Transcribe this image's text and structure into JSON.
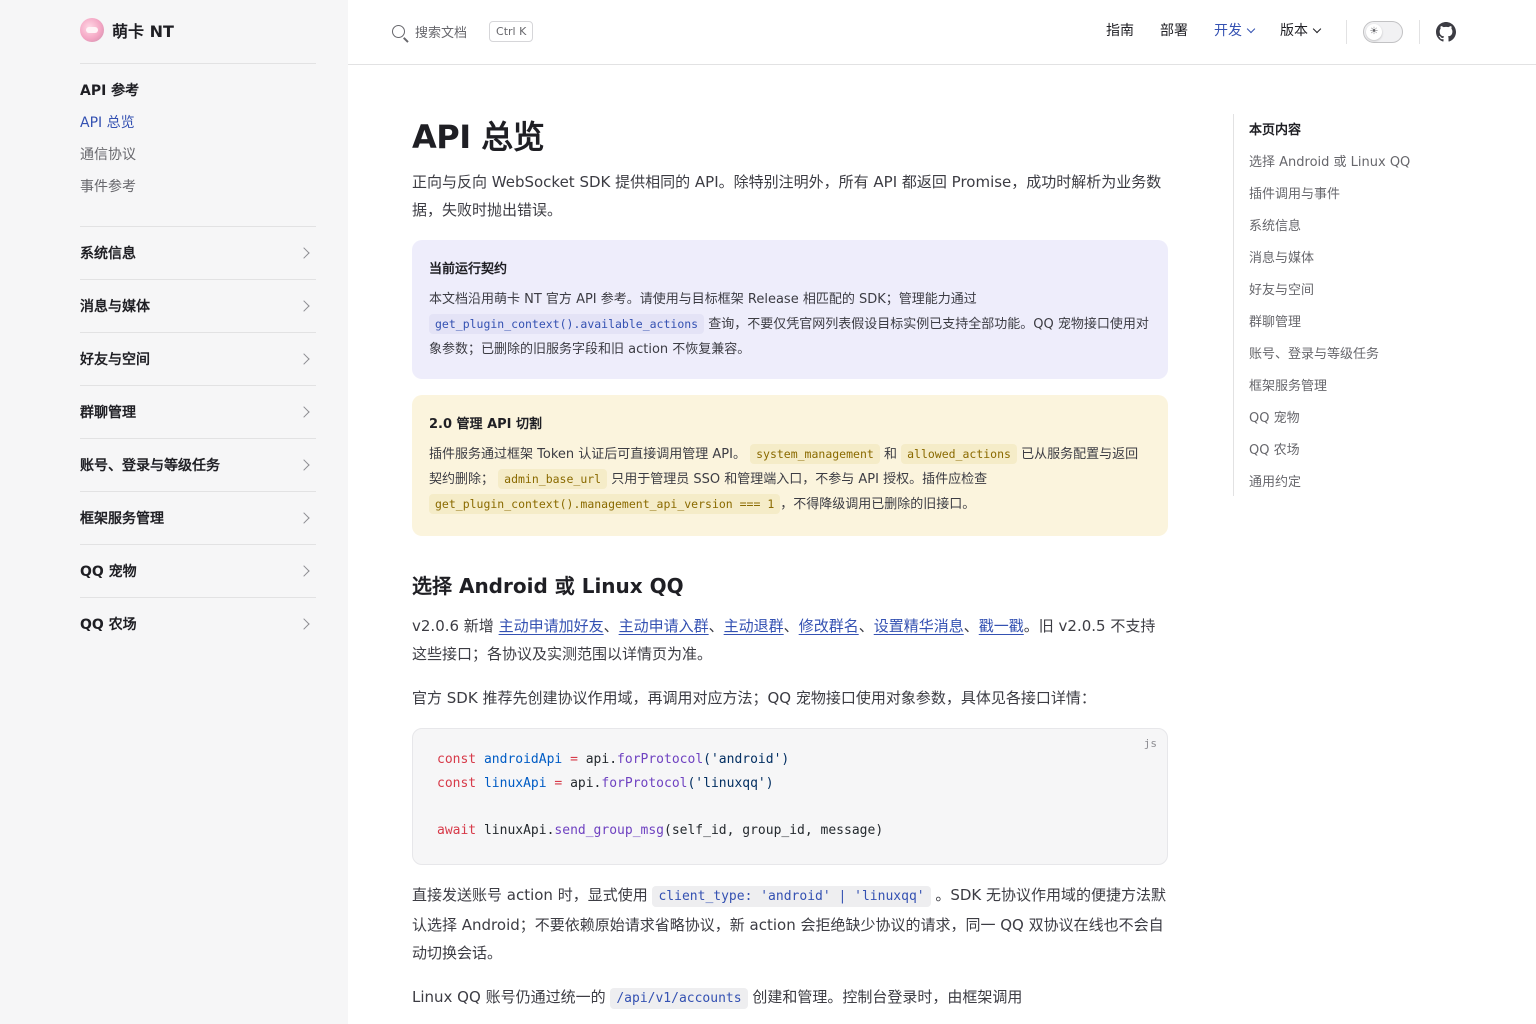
{
  "brand": {
    "title": "萌卡 NT"
  },
  "sidebar": {
    "group_title": "API 参考",
    "links": [
      {
        "label": "API 总览",
        "active": true
      },
      {
        "label": "通信协议",
        "active": false
      },
      {
        "label": "事件参考",
        "active": false
      }
    ],
    "sections": [
      {
        "label": "系统信息"
      },
      {
        "label": "消息与媒体"
      },
      {
        "label": "好友与空间"
      },
      {
        "label": "群聊管理"
      },
      {
        "label": "账号、登录与等级任务"
      },
      {
        "label": "框架服务管理"
      },
      {
        "label": "QQ 宠物"
      },
      {
        "label": "QQ 农场"
      }
    ]
  },
  "topnav": {
    "search_placeholder": "搜索文档",
    "search_shortcut": "Ctrl K",
    "items": [
      {
        "label": "指南",
        "active": false,
        "dropdown": false
      },
      {
        "label": "部署",
        "active": false,
        "dropdown": false
      },
      {
        "label": "开发",
        "active": true,
        "dropdown": true
      },
      {
        "label": "版本",
        "active": false,
        "dropdown": true
      }
    ],
    "theme_icon": "sun-icon",
    "github_icon": "github-icon"
  },
  "main": {
    "title": "API 总览",
    "intro": "正向与反向 WebSocket SDK 提供相同的 API。除特别注明外，所有 API 都返回 Promise，成功时解析为业务数据，失败时抛出错误。",
    "callout_info": {
      "title": "当前运行契约",
      "text1": "本文档沿用萌卡 NT 官方 API 参考。请使用与目标框架 Release 相匹配的 SDK；管理能力通过",
      "code1": "get_plugin_context().available_actions",
      "text2": "查询，不要仅凭官网列表假设目标实例已支持全部功能。QQ 宠物接口使用对象参数；已删除的旧服务字段和旧 action 不恢复兼容。"
    },
    "callout_warn": {
      "title": "2.0 管理 API 切割",
      "text1": "插件服务通过框架 Token 认证后可直接调用管理 API。",
      "code1": "system_management",
      "text2": "和",
      "code2": "allowed_actions",
      "text3": "已从服务配置与返回契约删除；",
      "code3": "admin_base_url",
      "text4": "只用于管理员 SSO 和管理端入口，不参与 API 授权。插件应检查",
      "code4": "get_plugin_context().management_api_version === 1",
      "text5": "，不得降级调用已删除的旧接口。"
    },
    "section_title": "选择 Android 或 Linux QQ",
    "p1": {
      "prefix": "v2.0.6 新增 ",
      "links": [
        "主动申请加好友",
        "主动申请入群",
        "主动退群",
        "修改群名",
        "设置精华消息",
        "戳一戳"
      ],
      "sep": "、",
      "suffix": "。旧 v2.0.5 不支持这些接口；各协议及实测范围以详情页为准。"
    },
    "p2": "官方 SDK 推荐先创建协议作用域，再调用对应方法；QQ 宠物接口使用对象参数，具体见各接口详情：",
    "code_block": {
      "lang": "js",
      "line1": {
        "kw": "const",
        "var": "androidApi",
        "eq": " = ",
        "obj": "api.",
        "fn": "forProtocol",
        "args": "('android')"
      },
      "line2": {
        "kw": "const",
        "var": "linuxApi",
        "eq": " = ",
        "obj": "api.",
        "fn": "forProtocol",
        "args": "('linuxqq')"
      },
      "line3": {
        "kw": "await",
        "obj": " linuxApi.",
        "fn": "send_group_msg",
        "args": "(self_id, group_id, message)"
      }
    },
    "p3": {
      "text1": "直接发送账号 action 时，显式使用 ",
      "code": "client_type: 'android' | 'linuxqq'",
      "text2": " 。SDK 无协议作用域的便捷方法默认选择 Android；不要依赖原始请求省略协议，新 action 会拒绝缺少协议的请求，同一 QQ 双协议在线也不会自动切换会话。"
    },
    "p4": {
      "text1": "Linux QQ 账号仍通过统一的 ",
      "code": "/api/v1/accounts",
      "text2": " 创建和管理。控制台登录时，由框架调用"
    }
  },
  "toc": {
    "title": "本页内容",
    "items": [
      "选择 Android 或 Linux QQ",
      "插件调用与事件",
      "系统信息",
      "消息与媒体",
      "好友与空间",
      "群聊管理",
      "账号、登录与等级任务",
      "框架服务管理",
      "QQ 宠物",
      "QQ 农场",
      "通用约定"
    ]
  }
}
